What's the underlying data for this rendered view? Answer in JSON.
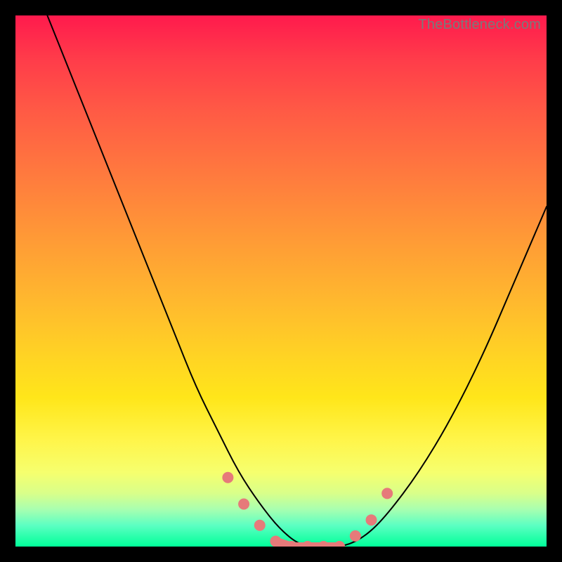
{
  "watermark": "TheBottleneck.com",
  "colors": {
    "frame": "#000000",
    "curve": "#000000",
    "marker": "#e67a7a",
    "gradient_top": "#ff1a4d",
    "gradient_bottom": "#00ff99"
  },
  "chart_data": {
    "type": "line",
    "title": "",
    "xlabel": "",
    "ylabel": "",
    "xlim": [
      0,
      100
    ],
    "ylim": [
      0,
      100
    ],
    "grid": false,
    "legend": false,
    "series": [
      {
        "name": "bottleneck-curve",
        "x": [
          6,
          10,
          14,
          18,
          22,
          26,
          30,
          34,
          38,
          42,
          46,
          50,
          54,
          58,
          62,
          66,
          70,
          76,
          82,
          88,
          94,
          100
        ],
        "y": [
          100,
          90,
          80,
          70,
          60,
          50,
          40,
          30,
          22,
          14,
          8,
          3,
          0,
          0,
          0,
          2,
          6,
          14,
          24,
          36,
          50,
          64
        ]
      }
    ],
    "markers": {
      "name": "highlight-points",
      "x": [
        40,
        43,
        46,
        49,
        52,
        55,
        58,
        61,
        64,
        67,
        70
      ],
      "y": [
        13,
        8,
        4,
        1,
        0,
        0,
        0,
        0,
        2,
        5,
        10
      ]
    },
    "annotations": []
  }
}
